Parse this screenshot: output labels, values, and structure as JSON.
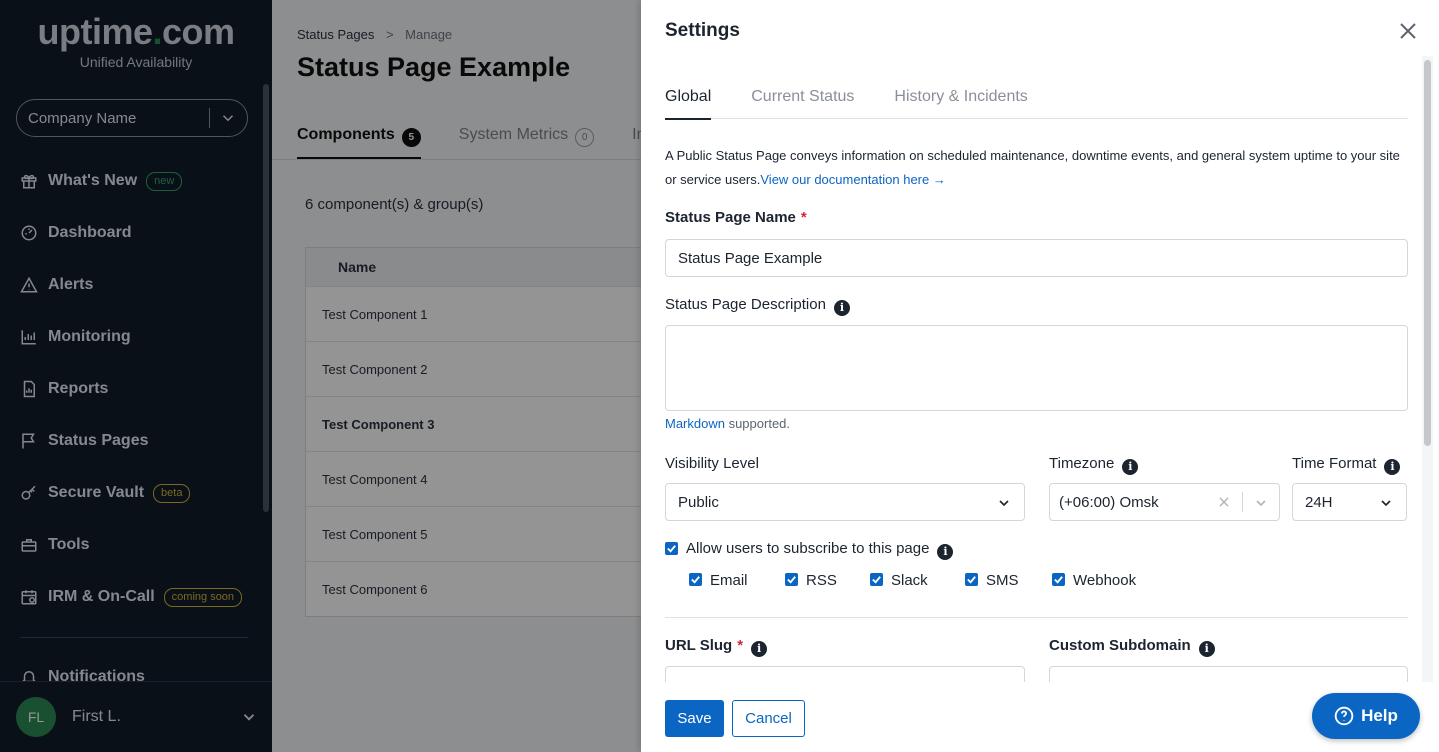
{
  "brand": {
    "logo_main": "uptime",
    "logo_dot": ".",
    "logo_tld": "com",
    "tagline": "Unified Availability"
  },
  "sidebar": {
    "company": "Company Name",
    "items": [
      {
        "label": "What's New",
        "icon": "gift-icon",
        "badge": "new"
      },
      {
        "label": "Dashboard",
        "icon": "dashboard-icon"
      },
      {
        "label": "Alerts",
        "icon": "warning-icon"
      },
      {
        "label": "Monitoring",
        "icon": "chart-icon"
      },
      {
        "label": "Reports",
        "icon": "report-icon"
      },
      {
        "label": "Status Pages",
        "icon": "flag-icon"
      },
      {
        "label": "Secure Vault",
        "icon": "key-icon",
        "badge": "beta"
      },
      {
        "label": "Tools",
        "icon": "toolbox-icon"
      },
      {
        "label": "IRM & On-Call",
        "icon": "calendar-icon",
        "badge": "coming soon"
      }
    ],
    "notifications": "Notifications",
    "user": {
      "initials": "FL",
      "name": "First L."
    }
  },
  "main": {
    "breadcrumb": [
      "Status Pages",
      ">",
      "Manage"
    ],
    "title": "Status Page Example",
    "tabs": [
      {
        "label": "Components",
        "count": "5"
      },
      {
        "label": "System Metrics",
        "count": "0"
      },
      {
        "label": "In"
      }
    ],
    "component_count": "6 component(s) & group(s)",
    "table": {
      "header": "Name",
      "rows": [
        "Test Component 1",
        "Test Component 2",
        "Test Component 3",
        "Test Component 4",
        "Test Component 5",
        "Test Component 6"
      ]
    }
  },
  "settings": {
    "title": "Settings",
    "tabs": [
      "Global",
      "Current Status",
      "History & Incidents"
    ],
    "intro": "A Public Status Page conveys information on scheduled maintenance, downtime events, and general system uptime to your site or service users.",
    "doc_link": "View our documentation here →",
    "name_label": "Status Page Name",
    "name_value": "Status Page Example",
    "desc_label": "Status Page Description",
    "desc_value": "",
    "markdown_link": "Markdown",
    "markdown_suffix": " supported.",
    "visibility_label": "Visibility Level",
    "visibility_value": "Public",
    "timezone_label": "Timezone",
    "timezone_value": "(+06:00) Omsk",
    "timeformat_label": "Time Format",
    "timeformat_value": "24H",
    "subscribe_label": "Allow users to subscribe to this page",
    "subscribe_checked": true,
    "channels": [
      {
        "label": "Email",
        "checked": true
      },
      {
        "label": "RSS",
        "checked": true
      },
      {
        "label": "Slack",
        "checked": true
      },
      {
        "label": "SMS",
        "checked": true
      },
      {
        "label": "Webhook",
        "checked": true
      }
    ],
    "slug_label": "URL Slug",
    "subdomain_label": "Custom Subdomain",
    "save": "Save",
    "cancel": "Cancel"
  },
  "help": "Help",
  "colors": {
    "accent": "#0b66c3",
    "sidebar_bg": "#111c2a",
    "required": "#d0263b",
    "brand_green": "#2e8b57"
  }
}
